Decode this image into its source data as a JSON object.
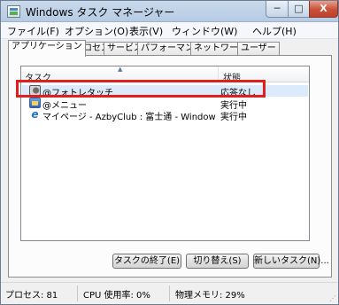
{
  "window": {
    "title": "Windows タスク マネージャー",
    "minimize_glyph": "─",
    "maximize_glyph": "□",
    "close_glyph": "X"
  },
  "menu": [
    {
      "label": "ファイル(F)"
    },
    {
      "label": "オプション(O)"
    },
    {
      "label": "表示(V)"
    },
    {
      "label": "ウィンドウ(W)"
    },
    {
      "label": "ヘルプ(H)"
    }
  ],
  "tabs": [
    {
      "label": "アプリケーション",
      "active": true
    },
    {
      "label": "プロセス"
    },
    {
      "label": "サービス"
    },
    {
      "label": "パフォーマンス"
    },
    {
      "label": "ネットワーク"
    },
    {
      "label": "ユーザー"
    }
  ],
  "list": {
    "columns": {
      "task": "タスク",
      "status": "状態"
    },
    "sort_indicator": "▲",
    "rows": [
      {
        "icon": "photo-touch-icon",
        "name": "@フォトレタッチ",
        "status": "応答なし",
        "selected": true
      },
      {
        "icon": "menu-app-icon",
        "name": "@メニュー",
        "status": "実行中"
      },
      {
        "icon": "internet-explorer-icon",
        "name": "マイページ - AzbyClub : 富士通 - Windows Inte...",
        "status": "実行中"
      }
    ]
  },
  "buttons": {
    "end_task": "タスクの終了(E)",
    "switch_to": "切り替え(S)",
    "new_task": "新しいタスク(N)..."
  },
  "status_bar": {
    "processes": "プロセス: 81",
    "cpu": "CPU 使用率: 0%",
    "memory": "物理メモリ: 29%"
  },
  "colors": {
    "highlight_border": "#e0201c",
    "close_button": "#c94f38",
    "title_bar": "#c9d9ec"
  }
}
